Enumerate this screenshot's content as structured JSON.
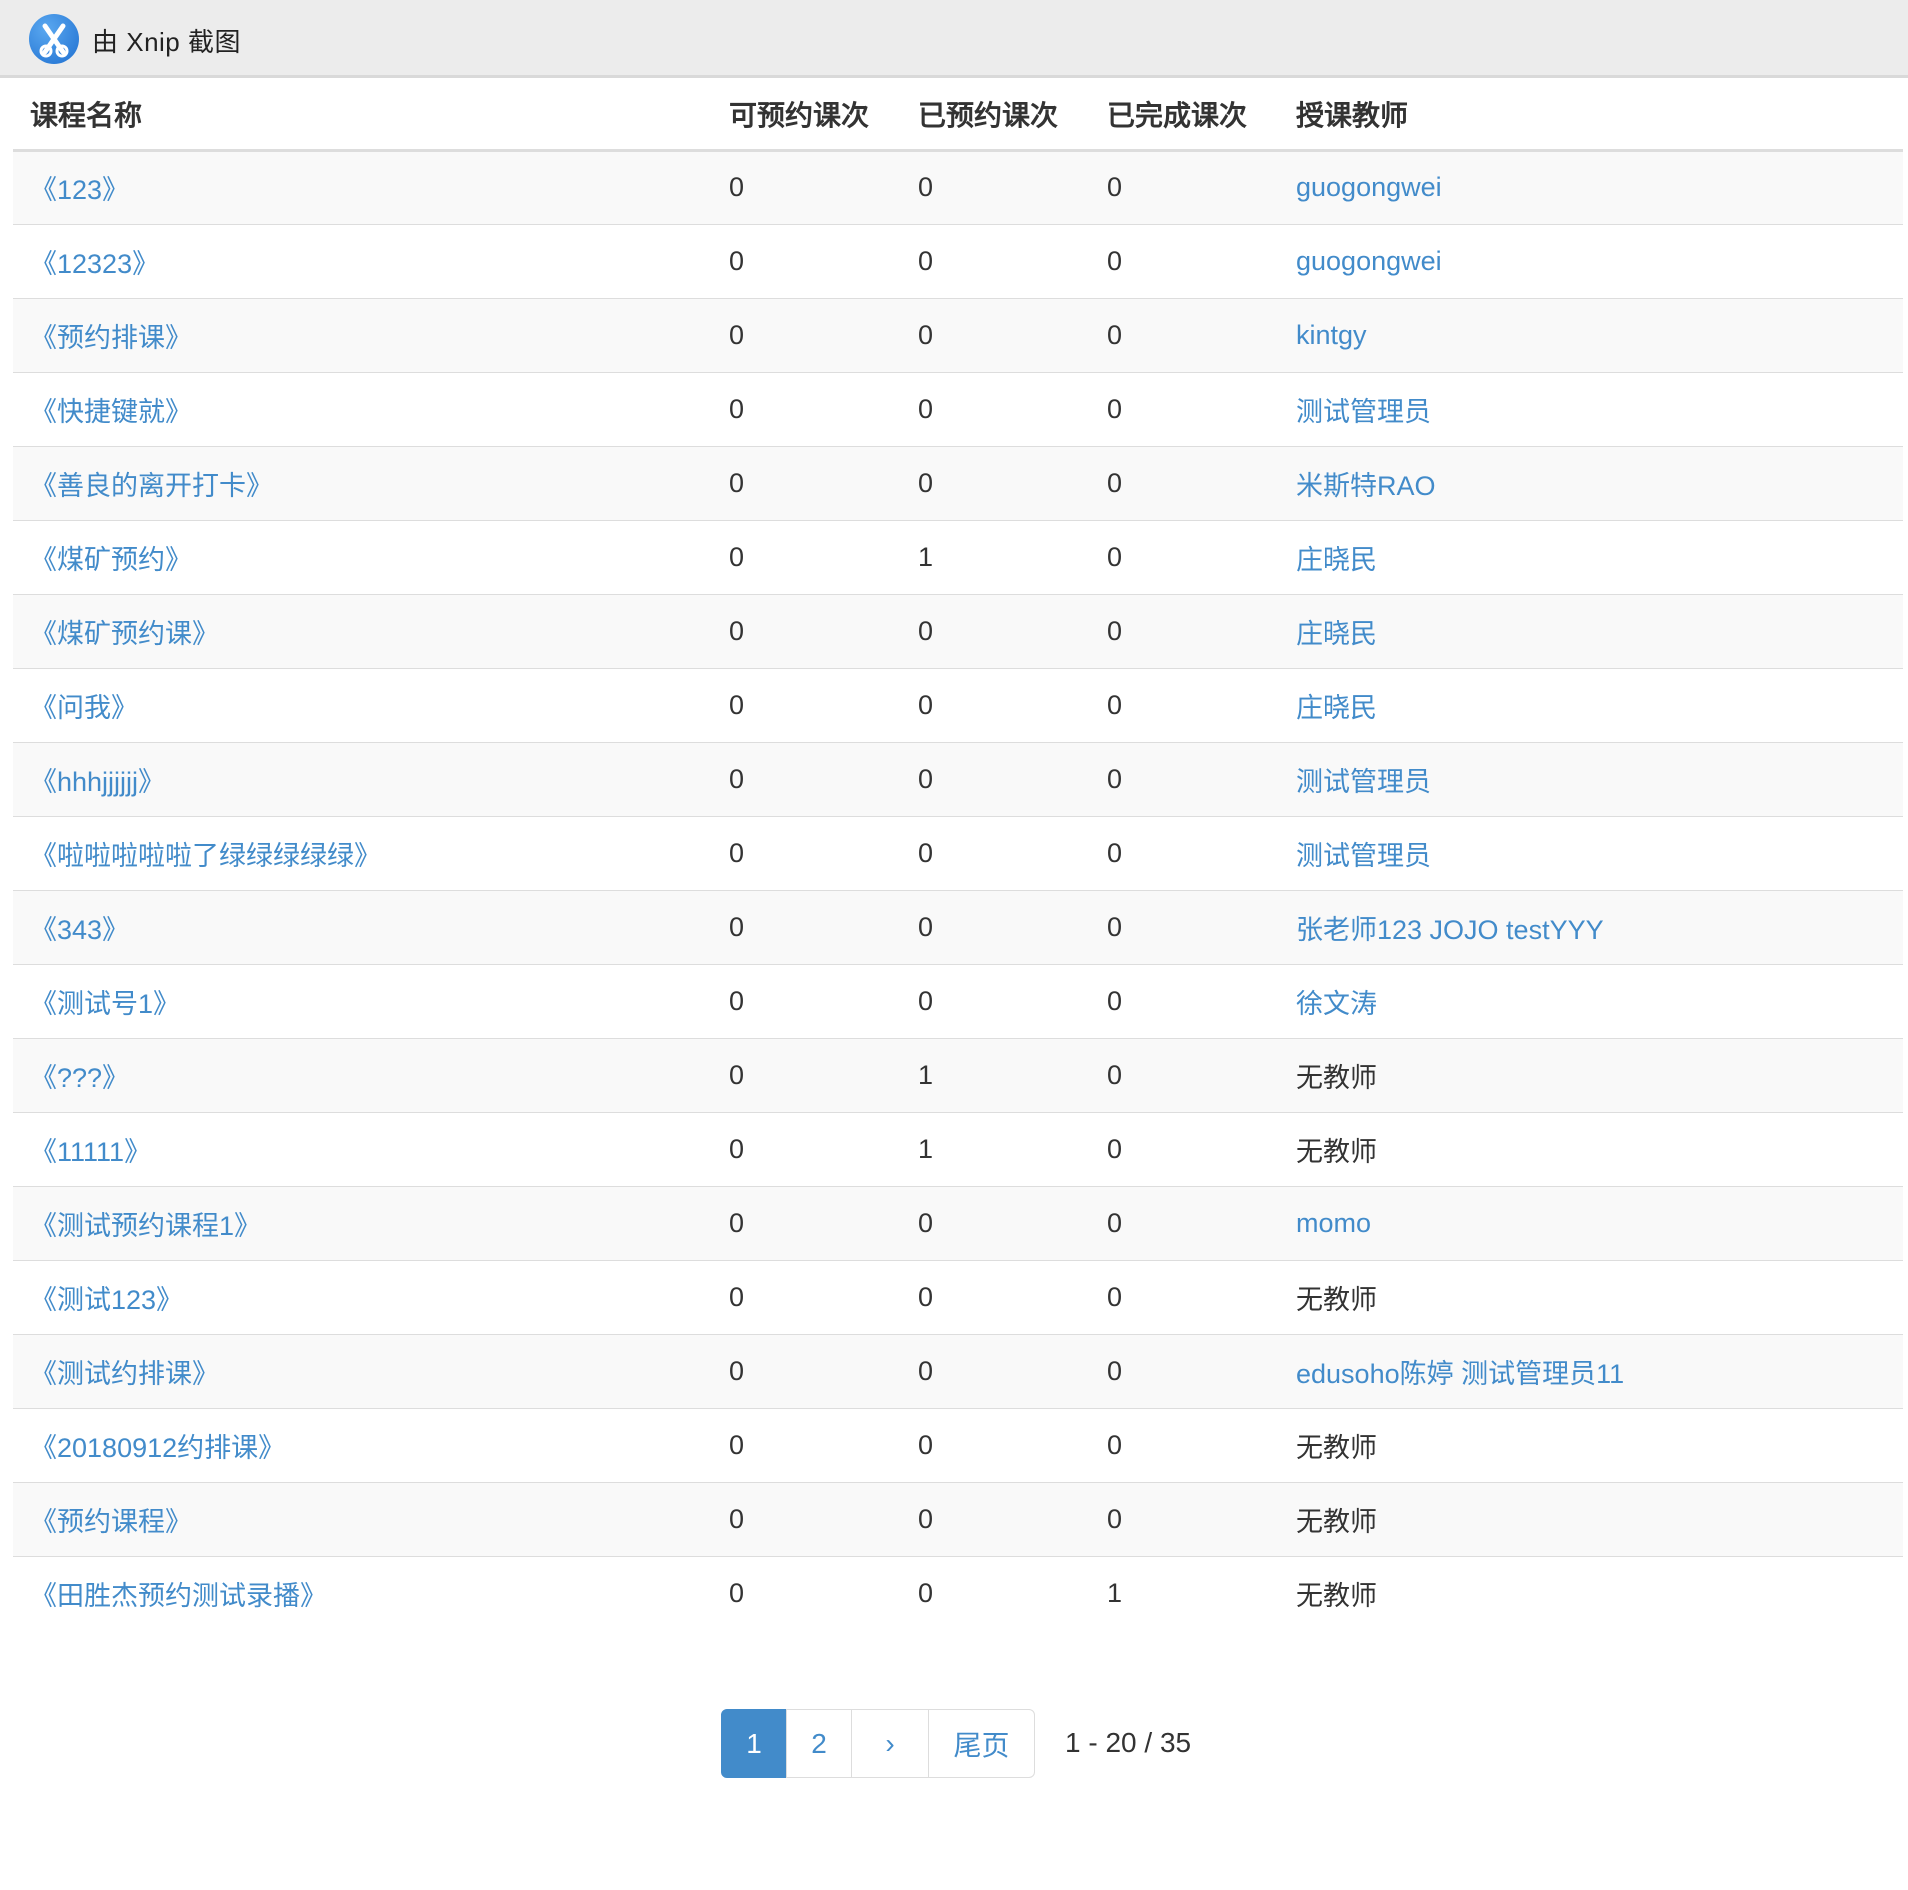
{
  "titlebar": {
    "text": "由 Xnip 截图"
  },
  "table": {
    "headers": {
      "name": "课程名称",
      "available": "可预约课次",
      "booked": "已预约课次",
      "completed": "已完成课次",
      "teacher": "授课教师"
    },
    "rows": [
      {
        "name": "《123》",
        "available": "0",
        "booked": "0",
        "completed": "0",
        "teacher": "guogongwei",
        "teacher_link": true
      },
      {
        "name": "《12323》",
        "available": "0",
        "booked": "0",
        "completed": "0",
        "teacher": "guogongwei",
        "teacher_link": true
      },
      {
        "name": "《预约排课》",
        "available": "0",
        "booked": "0",
        "completed": "0",
        "teacher": "kintgy",
        "teacher_link": true
      },
      {
        "name": "《快捷键就》",
        "available": "0",
        "booked": "0",
        "completed": "0",
        "teacher": "测试管理员",
        "teacher_link": true
      },
      {
        "name": "《善良的离开打卡》",
        "available": "0",
        "booked": "0",
        "completed": "0",
        "teacher": "米斯特RAO",
        "teacher_link": true
      },
      {
        "name": "《煤矿预约》",
        "available": "0",
        "booked": "1",
        "completed": "0",
        "teacher": "庄晓民",
        "teacher_link": true
      },
      {
        "name": "《煤矿预约课》",
        "available": "0",
        "booked": "0",
        "completed": "0",
        "teacher": "庄晓民",
        "teacher_link": true
      },
      {
        "name": "《问我》",
        "available": "0",
        "booked": "0",
        "completed": "0",
        "teacher": "庄晓民",
        "teacher_link": true
      },
      {
        "name": "《hhhjjjjjj》",
        "available": "0",
        "booked": "0",
        "completed": "0",
        "teacher": "测试管理员",
        "teacher_link": true
      },
      {
        "name": "《啦啦啦啦啦了绿绿绿绿绿》",
        "available": "0",
        "booked": "0",
        "completed": "0",
        "teacher": "测试管理员",
        "teacher_link": true
      },
      {
        "name": "《343》",
        "available": "0",
        "booked": "0",
        "completed": "0",
        "teacher": "张老师123 JOJO testYYY",
        "teacher_link": true
      },
      {
        "name": "《测试号1》",
        "available": "0",
        "booked": "0",
        "completed": "0",
        "teacher": "徐文涛",
        "teacher_link": true
      },
      {
        "name": "《???》",
        "available": "0",
        "booked": "1",
        "completed": "0",
        "teacher": "无教师",
        "teacher_link": false
      },
      {
        "name": "《11111》",
        "available": "0",
        "booked": "1",
        "completed": "0",
        "teacher": "无教师",
        "teacher_link": false
      },
      {
        "name": "《测试预约课程1》",
        "available": "0",
        "booked": "0",
        "completed": "0",
        "teacher": "momo",
        "teacher_link": true
      },
      {
        "name": "《测试123》",
        "available": "0",
        "booked": "0",
        "completed": "0",
        "teacher": "无教师",
        "teacher_link": false
      },
      {
        "name": "《测试约排课》",
        "available": "0",
        "booked": "0",
        "completed": "0",
        "teacher": "edusoho陈婷 测试管理员11",
        "teacher_link": true
      },
      {
        "name": "《20180912约排课》",
        "available": "0",
        "booked": "0",
        "completed": "0",
        "teacher": "无教师",
        "teacher_link": false
      },
      {
        "name": "《预约课程》",
        "available": "0",
        "booked": "0",
        "completed": "0",
        "teacher": "无教师",
        "teacher_link": false
      },
      {
        "name": "《田胜杰预约测试录播》",
        "available": "0",
        "booked": "0",
        "completed": "1",
        "teacher": "无教师",
        "teacher_link": false
      }
    ]
  },
  "pagination": {
    "page1": "1",
    "page2": "2",
    "next": "›",
    "last": "尾页",
    "info": "1 - 20 / 35"
  },
  "colors": {
    "link": "#428bca",
    "active_page": "#428bca"
  }
}
